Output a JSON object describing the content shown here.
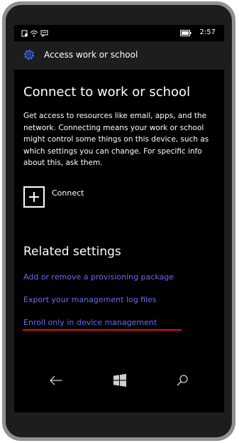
{
  "status": {
    "time": "2:57",
    "icons": [
      "notification-icon",
      "wifi-icon",
      "message-icon",
      "battery-icon"
    ]
  },
  "header": {
    "title": "Access work or school",
    "icon": "gear-icon"
  },
  "main": {
    "heading": "Connect to work or school",
    "description": "Get access to resources like email, apps, and the network. Connecting means your work or school might control some things on this device, such as which settings you can change. For specific info about this, ask them.",
    "connect_label": "Connect"
  },
  "related": {
    "heading": "Related settings",
    "links": [
      "Add or remove a provisioning package",
      "Export your management log files",
      "Enroll only in device management"
    ]
  },
  "nav": {
    "buttons": [
      "back-icon",
      "windows-icon",
      "search-icon"
    ]
  },
  "colors": {
    "link": "#6a6af2",
    "accent": "#3b62ff",
    "annotation_underline": "#dd1111"
  }
}
